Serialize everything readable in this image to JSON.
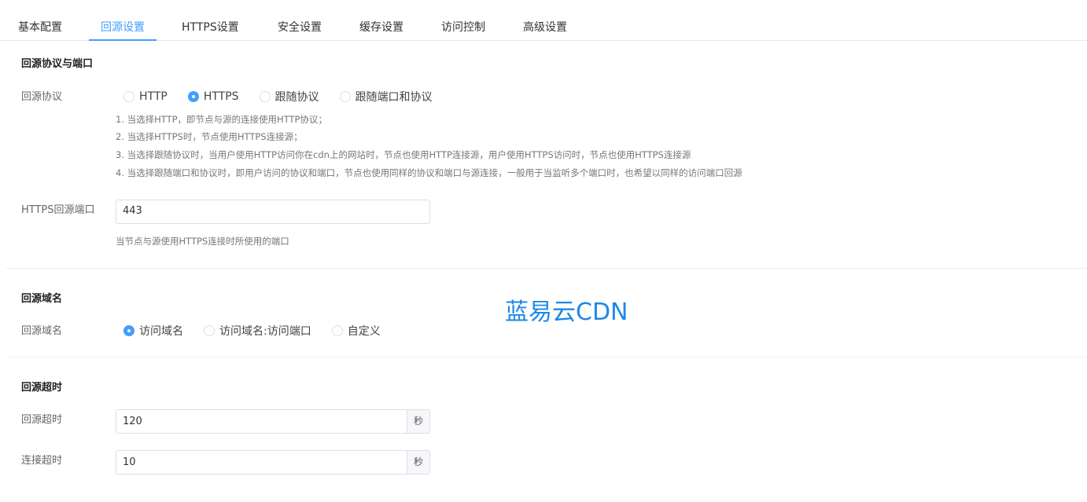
{
  "tabs": [
    {
      "label": "基本配置"
    },
    {
      "label": "回源设置"
    },
    {
      "label": "HTTPS设置"
    },
    {
      "label": "安全设置"
    },
    {
      "label": "缓存设置"
    },
    {
      "label": "访问控制"
    },
    {
      "label": "高级设置"
    }
  ],
  "protocol_section": {
    "title": "回源协议与端口",
    "protocol_label": "回源协议",
    "options": [
      "HTTP",
      "HTTPS",
      "跟随协议",
      "跟随端口和协议"
    ],
    "selected": "HTTPS",
    "hints": [
      "1. 当选择HTTP，即节点与源的连接使用HTTP协议；",
      "2. 当选择HTTPS时，节点使用HTTPS连接源；",
      "3. 当选择跟随协议时，当用户使用HTTP访问你在cdn上的网站时，节点也使用HTTP连接源，用户使用HTTPS访问时，节点也使用HTTPS连接源",
      "4. 当选择跟随端口和协议时，即用户访问的协议和端口，节点也使用同样的协议和端口与源连接，一般用于当监听多个端口时，也希望以同样的访问端口回源"
    ],
    "port_label": "HTTPS回源端口",
    "port_value": "443",
    "port_hint": "当节点与源使用HTTPS连接时所使用的端口"
  },
  "domain_section": {
    "title": "回源域名",
    "label": "回源域名",
    "options": [
      "访问域名",
      "访问域名:访问端口",
      "自定义"
    ],
    "selected": "访问域名"
  },
  "watermark": "蓝易云CDN",
  "timeout_section": {
    "title": "回源超时",
    "origin_label": "回源超时",
    "origin_value": "120",
    "connect_label": "连接超时",
    "connect_value": "10",
    "unit": "秒"
  },
  "colors": {
    "accent": "#409eff",
    "watermark": "#1e88e5"
  }
}
